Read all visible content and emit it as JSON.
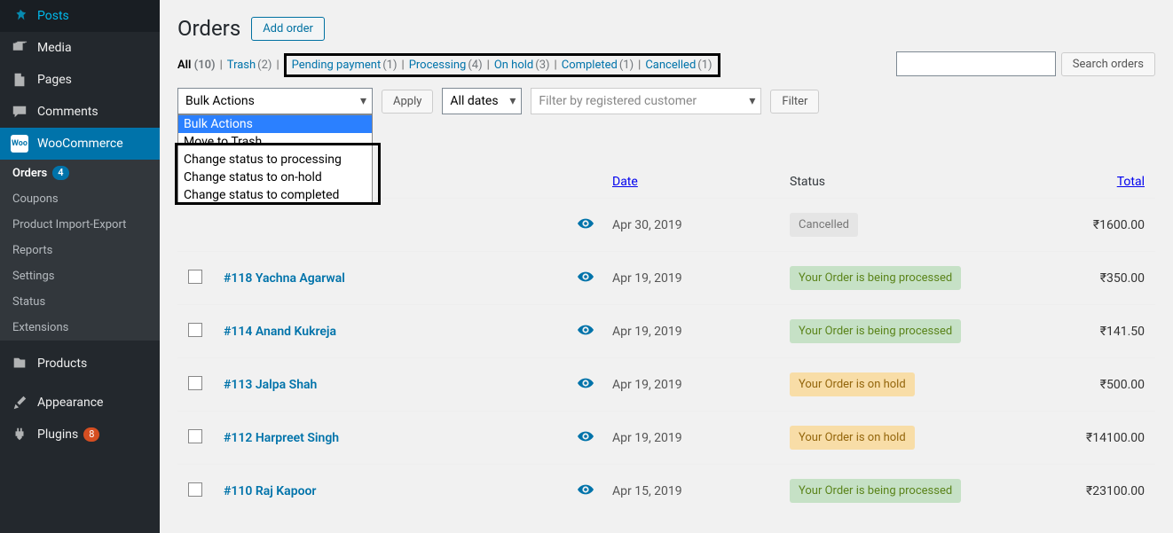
{
  "page_title": "Orders",
  "add_order": "Add order",
  "sidebar": {
    "items": [
      {
        "name": "posts",
        "label": "Posts"
      },
      {
        "name": "media",
        "label": "Media"
      },
      {
        "name": "pages",
        "label": "Pages"
      },
      {
        "name": "comments",
        "label": "Comments"
      },
      {
        "name": "woocommerce",
        "label": "WooCommerce"
      },
      {
        "name": "products",
        "label": "Products"
      },
      {
        "name": "appearance",
        "label": "Appearance"
      },
      {
        "name": "plugins",
        "label": "Plugins",
        "badge": "8"
      }
    ],
    "woo_sub": [
      {
        "name": "orders",
        "label": "Orders",
        "badge": "4",
        "active": true
      },
      {
        "name": "coupons",
        "label": "Coupons"
      },
      {
        "name": "product-import-export",
        "label": "Product Import-Export"
      },
      {
        "name": "reports",
        "label": "Reports"
      },
      {
        "name": "settings",
        "label": "Settings"
      },
      {
        "name": "status",
        "label": "Status"
      },
      {
        "name": "extensions",
        "label": "Extensions"
      }
    ]
  },
  "status_filters": [
    {
      "label": "All",
      "count": "(10)",
      "current": true
    },
    {
      "label": "Trash",
      "count": "(2)"
    },
    {
      "label": "Pending payment",
      "count": "(1)",
      "highlighted": true
    },
    {
      "label": "Processing",
      "count": "(4)",
      "highlighted": true
    },
    {
      "label": "On hold",
      "count": "(3)",
      "highlighted": true
    },
    {
      "label": "Completed",
      "count": "(1)",
      "highlighted": true
    },
    {
      "label": "Cancelled",
      "count": "(1)",
      "highlighted": true
    }
  ],
  "bulk_actions": {
    "label": "Bulk Actions",
    "options": [
      {
        "label": "Bulk Actions",
        "selected": true
      },
      {
        "label": "Move to Trash"
      },
      {
        "label": "Change status to processing",
        "highlighted": true
      },
      {
        "label": "Change status to on-hold",
        "highlighted": true
      },
      {
        "label": "Change status to completed",
        "highlighted": true
      }
    ]
  },
  "apply_label": "Apply",
  "all_dates_label": "All dates",
  "customer_filter_placeholder": "Filter by registered customer",
  "filter_label": "Filter",
  "search_orders_label": "Search orders",
  "table": {
    "headers": {
      "date": "Date",
      "status": "Status",
      "total": "Total"
    },
    "rows": [
      {
        "order": "",
        "date": "Apr 30, 2019",
        "status": "Cancelled",
        "status_class": "cancelled",
        "total": "₹1600.00"
      },
      {
        "order": "#118 Yachna Agarwal",
        "date": "Apr 19, 2019",
        "status": "Your Order is being processed",
        "status_class": "processing",
        "total": "₹350.00"
      },
      {
        "order": "#114 Anand Kukreja",
        "date": "Apr 19, 2019",
        "status": "Your Order is being processed",
        "status_class": "processing",
        "total": "₹141.50"
      },
      {
        "order": "#113 Jalpa Shah",
        "date": "Apr 19, 2019",
        "status": "Your Order is on hold",
        "status_class": "onhold",
        "total": "₹500.00"
      },
      {
        "order": "#112 Harpreet Singh",
        "date": "Apr 19, 2019",
        "status": "Your Order is on hold",
        "status_class": "onhold",
        "total": "₹14100.00"
      },
      {
        "order": "#110 Raj Kapoor",
        "date": "Apr 15, 2019",
        "status": "Your Order is being processed",
        "status_class": "processing",
        "total": "₹23100.00"
      }
    ]
  }
}
